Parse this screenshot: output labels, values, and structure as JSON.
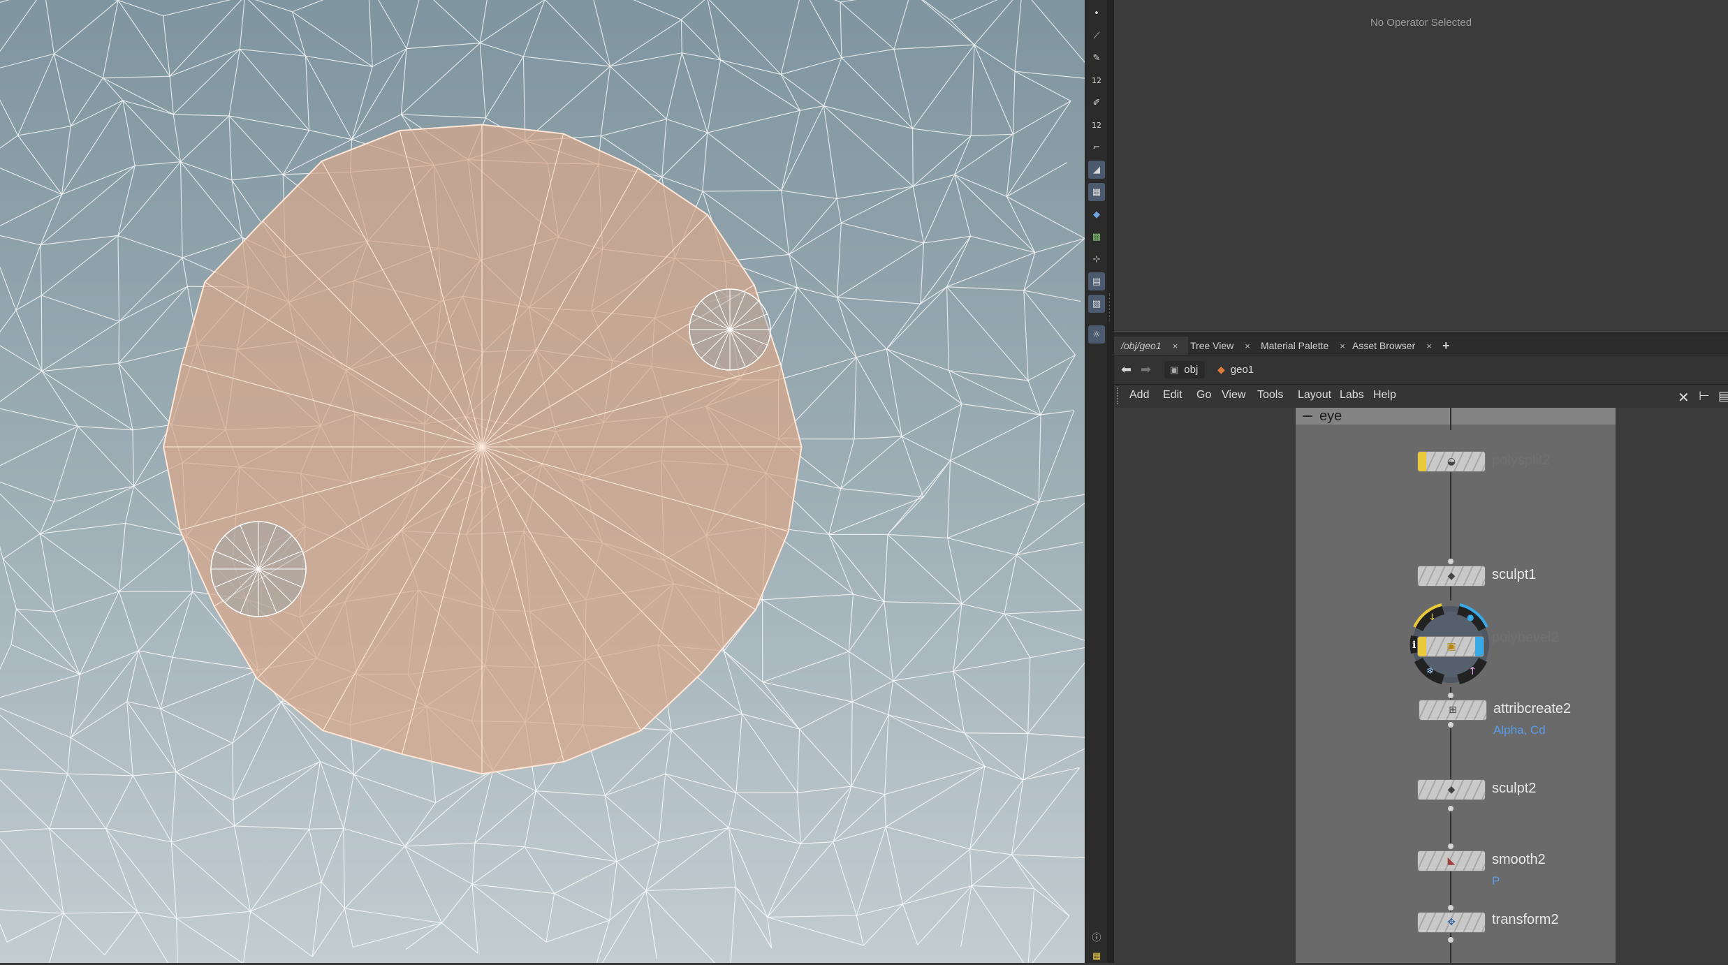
{
  "viewport": {
    "name": "3D Viewport"
  },
  "toolbar": {
    "tools": [
      "select-points-icon",
      "brush-icon",
      "pen-icon",
      "number-12-icon",
      "paint-icon",
      "paint-number-icon",
      "corner-icon",
      "sculpt-icon",
      "texture-icon",
      "diamond-icon",
      "grid-icon",
      "pivot-icon",
      "layer-icon",
      "image-icon",
      "light-icon",
      "info-icon",
      "layout-icon"
    ],
    "tool_labels": {
      "num1": "12",
      "num2": "12"
    }
  },
  "params": {
    "message": "No Operator Selected"
  },
  "tabs": [
    {
      "label": "/obj/geo1",
      "active": true
    },
    {
      "label": "Tree View",
      "active": false
    },
    {
      "label": "Material Palette",
      "active": false
    },
    {
      "label": "Asset Browser",
      "active": false
    }
  ],
  "tab_close": "×",
  "tab_add": "+",
  "path": {
    "root": "obj",
    "current": "geo1"
  },
  "menu": [
    "Add",
    "Edit",
    "Go",
    "View",
    "Tools",
    "Layout",
    "Labs",
    "Help"
  ],
  "network": {
    "box_title": "eye",
    "nodes": [
      {
        "name": "polysplit2",
        "faded": true
      },
      {
        "name": "sculpt1",
        "faded": false
      },
      {
        "name": "polybevel2",
        "faded": true
      },
      {
        "name": "attribcreate2",
        "faded": false,
        "sub": "Alpha, Cd"
      },
      {
        "name": "sculpt2",
        "faded": false
      },
      {
        "name": "smooth2",
        "faded": false,
        "sub": "P"
      },
      {
        "name": "transform2",
        "faded": false
      }
    ]
  },
  "colors": {
    "accent_yellow": "#e8c93a",
    "accent_blue": "#39a9e6",
    "attr_blue": "#5a9ce6",
    "mesh_fill": "#d8a88a"
  }
}
